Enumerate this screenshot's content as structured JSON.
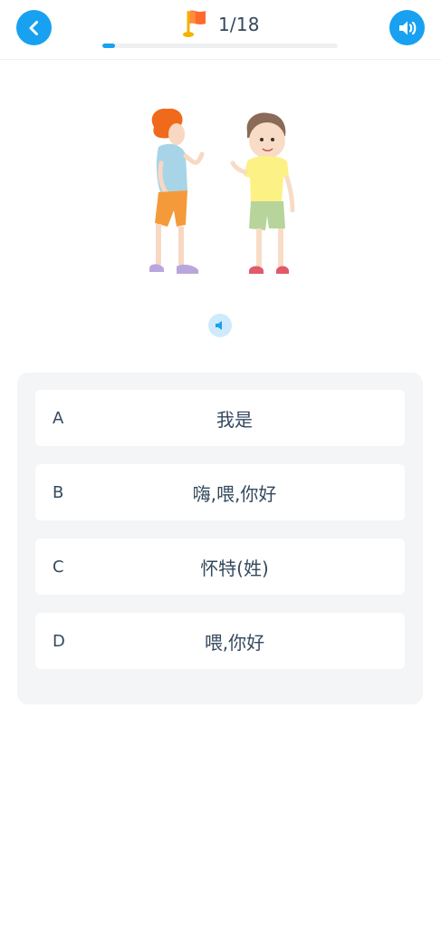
{
  "header": {
    "progress_text": "1/18",
    "progress_fraction": 0.0556,
    "icons": {
      "back": "chevron-left-icon",
      "flag": "flag-icon",
      "audio": "speaker-icon"
    }
  },
  "question": {
    "illustration": "two-boys-waving-illustration",
    "audio_icon": "small-speaker-icon"
  },
  "options": [
    {
      "letter": "A",
      "text": "我是"
    },
    {
      "letter": "B",
      "text": "嗨,喂,你好"
    },
    {
      "letter": "C",
      "text": "怀特(姓)"
    },
    {
      "letter": "D",
      "text": "喂,你好"
    }
  ],
  "colors": {
    "accent": "#18a1f0",
    "panel": "#f3f5f7",
    "text": "#34495e"
  }
}
